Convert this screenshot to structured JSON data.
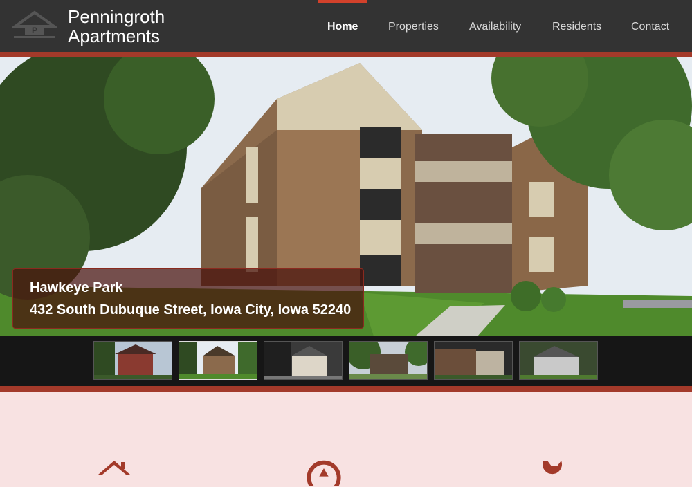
{
  "brand": {
    "line1": "Penningroth",
    "line2": "Apartments",
    "logo_letter": "P"
  },
  "nav": [
    {
      "label": "Home",
      "active": true
    },
    {
      "label": "Properties",
      "active": false
    },
    {
      "label": "Availability",
      "active": false
    },
    {
      "label": "Residents",
      "active": false
    },
    {
      "label": "Contact",
      "active": false
    }
  ],
  "hero": {
    "title": "Hawkeye Park",
    "address": "432 South Dubuque Street, Iowa City, Iowa 52240"
  },
  "thumbnails": [
    {
      "name": "victorian-house",
      "active": false
    },
    {
      "name": "hawkeye-park",
      "active": true
    },
    {
      "name": "townhouse",
      "active": false
    },
    {
      "name": "deck-house",
      "active": false
    },
    {
      "name": "brick-duplex",
      "active": false
    },
    {
      "name": "cottage",
      "active": false
    }
  ],
  "colors": {
    "header": "#333333",
    "accent": "#a33a2a",
    "background": "#f8e2e2"
  },
  "features": [
    "home-icon",
    "gauge-icon",
    "wrench-icon"
  ]
}
